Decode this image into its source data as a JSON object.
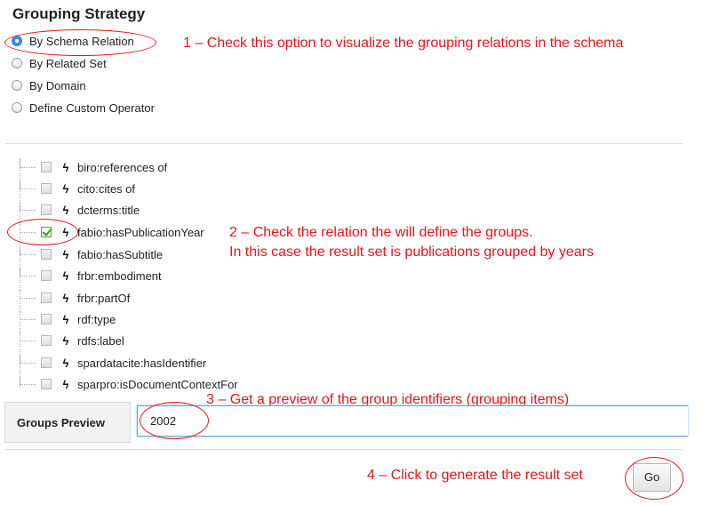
{
  "title": "Grouping Strategy",
  "strategies": [
    {
      "label": "By Schema Relation",
      "checked": true
    },
    {
      "label": "By Related Set",
      "checked": false
    },
    {
      "label": "By Domain",
      "checked": false
    },
    {
      "label": "Define Custom Operator",
      "checked": false
    }
  ],
  "relations": [
    {
      "label": "biro:references of",
      "checked": false
    },
    {
      "label": "cito:cites of",
      "checked": false
    },
    {
      "label": "dcterms:title",
      "checked": false
    },
    {
      "label": "fabio:hasPublicationYear",
      "checked": true
    },
    {
      "label": "fabio:hasSubtitle",
      "checked": false
    },
    {
      "label": "frbr:embodiment",
      "checked": false
    },
    {
      "label": "frbr:partOf",
      "checked": false
    },
    {
      "label": "rdf:type",
      "checked": false
    },
    {
      "label": "rdfs:label",
      "checked": false
    },
    {
      "label": "spardatacite:hasIdentifier",
      "checked": false
    },
    {
      "label": "sparpro:isDocumentContextFor",
      "checked": false
    }
  ],
  "relation_icon": "lightning-bolt-icon",
  "preview": {
    "label": "Groups Preview",
    "value": "2002"
  },
  "go_label": "Go",
  "annotations": {
    "a1": "1 – Check this option to visualize the grouping relations in the schema",
    "a2_line1": "2 – Check the relation the will define the groups.",
    "a2_line2": "In this case the result set is publications grouped by years",
    "a3": "3 – Get a preview of the group identifiers (grouping items)",
    "a4": "4 – Click to generate the result set"
  },
  "colors": {
    "annotation": "#e8141c",
    "radio_selected": "#3b8ee6",
    "check": "#3a9a1a"
  }
}
